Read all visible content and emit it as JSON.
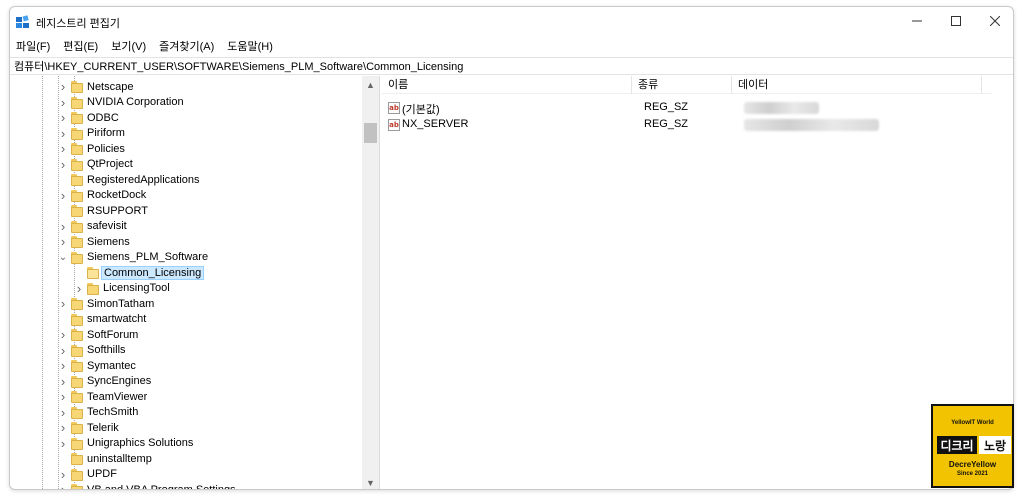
{
  "window": {
    "title": "레지스트리 편집기"
  },
  "menu": [
    "파일(F)",
    "편집(E)",
    "보기(V)",
    "즐겨찾기(A)",
    "도움말(H)"
  ],
  "address": "컴퓨터\\HKEY_CURRENT_USER\\SOFTWARE\\Siemens_PLM_Software\\Common_Licensing",
  "tree": {
    "items": [
      {
        "label": "Netscape",
        "expander": "collapsed"
      },
      {
        "label": "NVIDIA Corporation",
        "expander": "collapsed"
      },
      {
        "label": "ODBC",
        "expander": "collapsed"
      },
      {
        "label": "Piriform",
        "expander": "collapsed"
      },
      {
        "label": "Policies",
        "expander": "collapsed"
      },
      {
        "label": "QtProject",
        "expander": "collapsed"
      },
      {
        "label": "RegisteredApplications",
        "expander": "none"
      },
      {
        "label": "RocketDock",
        "expander": "collapsed"
      },
      {
        "label": "RSUPPORT",
        "expander": "none"
      },
      {
        "label": "safevisit",
        "expander": "collapsed"
      },
      {
        "label": "Siemens",
        "expander": "collapsed"
      },
      {
        "label": "Siemens_PLM_Software",
        "expander": "expanded"
      },
      {
        "label": "Common_Licensing",
        "expander": "none",
        "child": true,
        "selected": true
      },
      {
        "label": "LicensingTool",
        "expander": "collapsed",
        "child": true
      },
      {
        "label": "SimonTatham",
        "expander": "collapsed"
      },
      {
        "label": "smartwatcht",
        "expander": "none"
      },
      {
        "label": "SoftForum",
        "expander": "collapsed"
      },
      {
        "label": "Softhills",
        "expander": "collapsed"
      },
      {
        "label": "Symantec",
        "expander": "collapsed"
      },
      {
        "label": "SyncEngines",
        "expander": "collapsed"
      },
      {
        "label": "TeamViewer",
        "expander": "collapsed"
      },
      {
        "label": "TechSmith",
        "expander": "collapsed"
      },
      {
        "label": "Telerik",
        "expander": "collapsed"
      },
      {
        "label": "Unigraphics Solutions",
        "expander": "collapsed"
      },
      {
        "label": "uninstalltemp",
        "expander": "none"
      },
      {
        "label": "UPDF",
        "expander": "collapsed"
      },
      {
        "label": "VB and VBA Program Settings",
        "expander": "collapsed"
      }
    ]
  },
  "values": {
    "headers": {
      "name": "이름",
      "type": "종류",
      "data": "데이터"
    },
    "rows": [
      {
        "name": "(기본값)",
        "type": "REG_SZ",
        "data_hidden": true
      },
      {
        "name": "NX_SERVER",
        "type": "REG_SZ",
        "data_hidden": true
      }
    ],
    "type_icon": "ab"
  },
  "watermark": {
    "top": "YellowIT World",
    "k1": "디크리",
    "k2": "노랑",
    "bottom1": "DecreYellow",
    "bottom2": "Since 2021"
  },
  "colors": {
    "folder": "#f7d675",
    "selection": "#cce8ff",
    "watermark": "#f2c300"
  }
}
